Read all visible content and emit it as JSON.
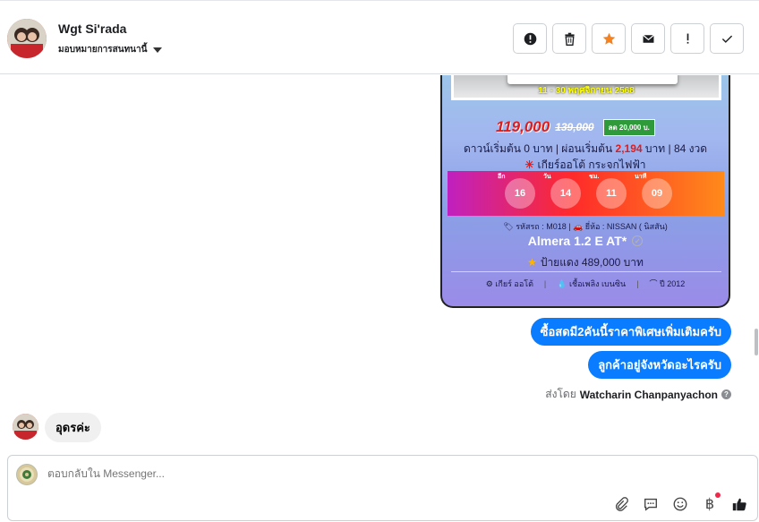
{
  "header": {
    "contact_name": "Wgt Si'rada",
    "assign_label": "มอบหมายการสนทนานี้",
    "actions": [
      {
        "name": "spam-button",
        "icon": "exclamation-circle-icon"
      },
      {
        "name": "delete-button",
        "icon": "trash-icon"
      },
      {
        "name": "star-button",
        "icon": "star-icon"
      },
      {
        "name": "mark-unread-button",
        "icon": "envelope-icon"
      },
      {
        "name": "follow-up-button",
        "icon": "exclamation-icon"
      },
      {
        "name": "done-button",
        "icon": "checkmark-icon"
      }
    ]
  },
  "card": {
    "date_text": "11 - 30 พฤศจิกายน 2568",
    "price_new": "119,000",
    "price_old": "139,000",
    "discount": "ลด 20,000 บ.",
    "down_pre": "ดาวน์เริ่มต้น 0 บาท | ผ่อนเริ่มต้น",
    "down_highlight": "2,194",
    "down_post": "บาท | 84 งวด",
    "auto_text": "เกียร์ออโต้ กระจกไฟฟ้า",
    "countdown": [
      {
        "label": "วัน",
        "top_label": "อีก",
        "value": "16"
      },
      {
        "label": "วัน",
        "top_label": "วัน",
        "value": "14"
      },
      {
        "label": "ชม.",
        "top_label": "ชม.",
        "value": "11"
      },
      {
        "label": "นาที",
        "top_label": "นาที",
        "value": "09"
      }
    ],
    "code_text": "🏷 รหัสรถ : M018 | 🚗 ยี่ห้อ : NISSAN ( นิสสัน)",
    "model": "Almera 1.2 E AT*",
    "plate": "ป้ายแดง 489,000 บาท",
    "specs": [
      "⚙ เกียร์ ออโต้",
      "💧 เชื้อเพลิง เบนซิน",
      "⌒ ปี 2012"
    ]
  },
  "messages": {
    "out1": "ซื้อสดมี2คันนี้ราคาพิเศษเพิ่มเติมครับ",
    "out2": "ลูกค้าอยู่จังหวัดอะไรครับ",
    "sent_by_prefix": "ส่งโดย",
    "sent_by_name": "Watcharin Chanpanyachon",
    "in1": "อุดรค่ะ"
  },
  "composer": {
    "placeholder": "ตอบกลับใน Messenger..."
  },
  "colors": {
    "accent": "#0a7cff",
    "star": "#f5821f"
  }
}
